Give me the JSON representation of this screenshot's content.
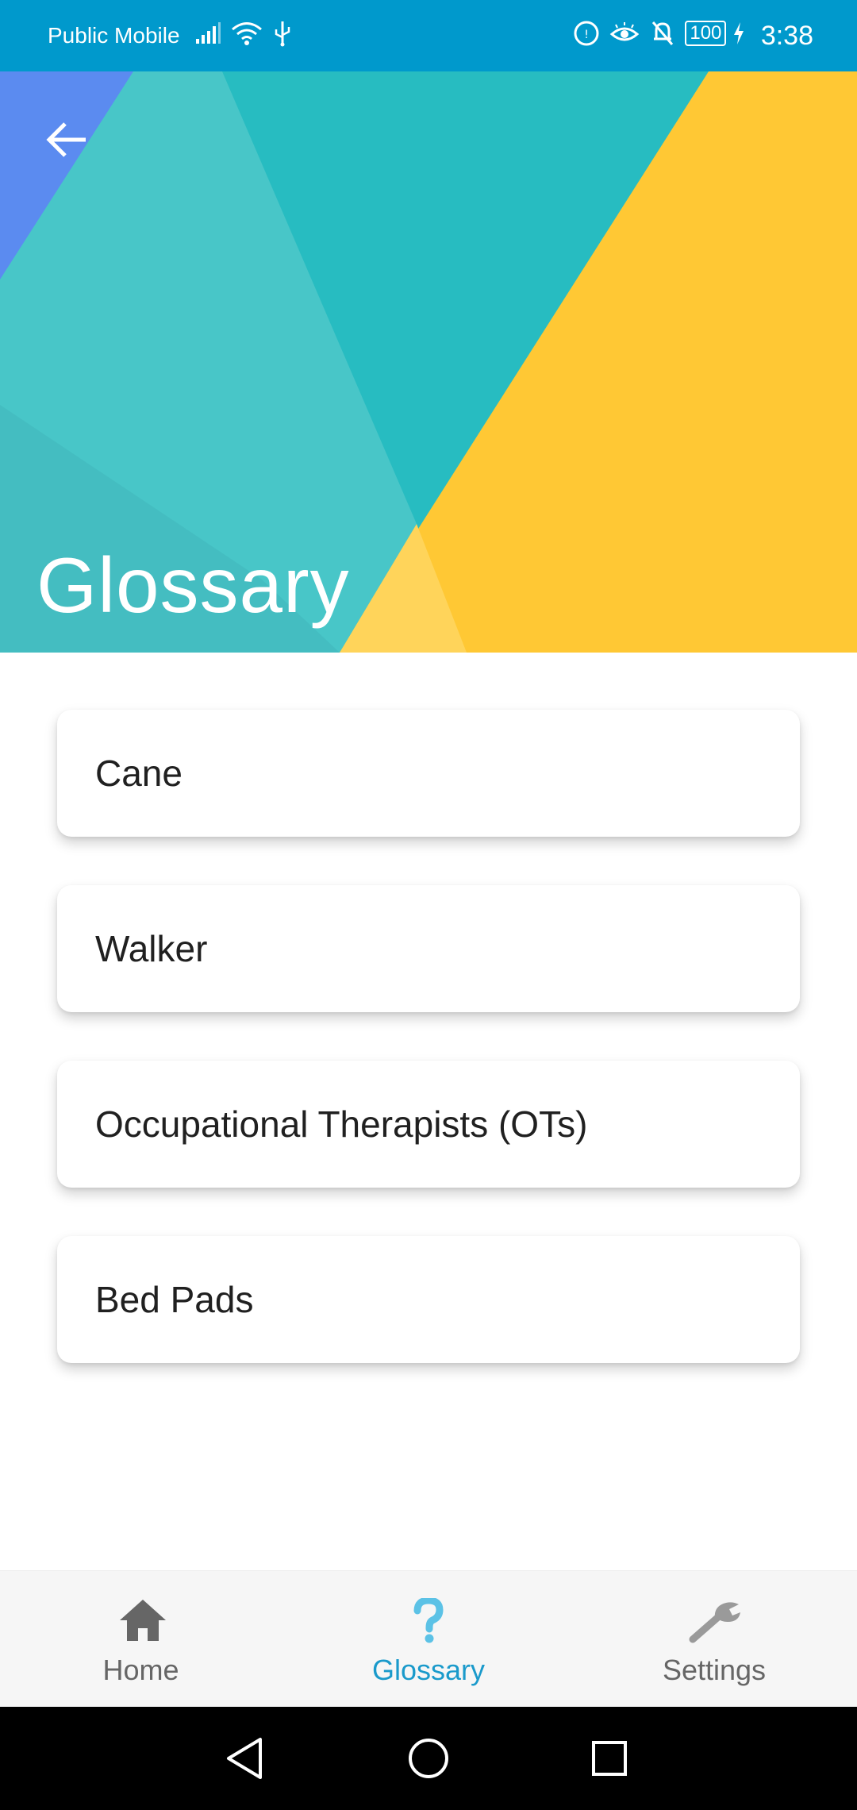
{
  "status_bar": {
    "carrier": "Public Mobile",
    "battery": "100",
    "time": "3:38"
  },
  "header": {
    "title": "Glossary",
    "colors": {
      "teal": "#27bcc1",
      "light_teal": "#48c6c8",
      "blue": "#5b8bf0",
      "yellow": "#ffc834"
    }
  },
  "glossary": {
    "items": [
      {
        "label": "Cane"
      },
      {
        "label": "Walker"
      },
      {
        "label": "Occupational Therapists (OTs)"
      },
      {
        "label": "Bed Pads"
      }
    ]
  },
  "bottom_nav": {
    "items": [
      {
        "label": "Home",
        "icon": "home-icon"
      },
      {
        "label": "Glossary",
        "icon": "question-mark-icon",
        "active": true
      },
      {
        "label": "Settings",
        "icon": "wrench-icon"
      }
    ],
    "active_color": "#1a9acb"
  },
  "system_nav": {
    "icons": [
      "back-triangle-icon",
      "home-circle-icon",
      "recents-square-icon"
    ]
  }
}
